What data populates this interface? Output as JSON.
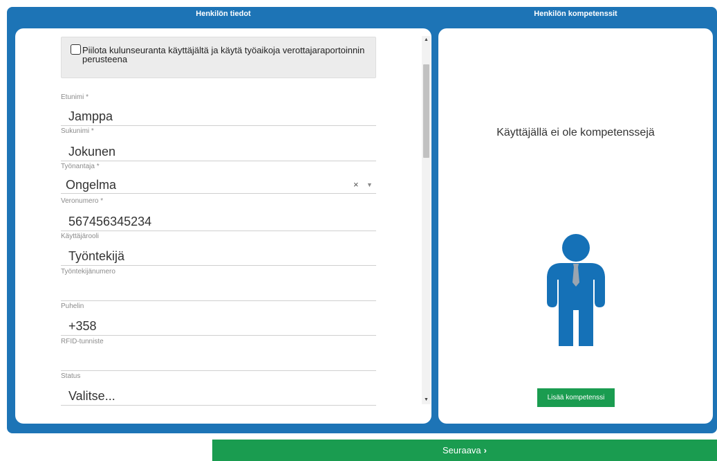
{
  "panels": {
    "left_title": "Henkilön tiedot",
    "right_title": "Henkilön kompetenssit"
  },
  "notice": {
    "checkbox_checked": false,
    "text": "Piilota kulunseuranta käyttäjältä ja käytä työaikoja verottajaraportoinnin perusteena"
  },
  "fields": {
    "first_name": {
      "label": "Etunimi",
      "required": "*",
      "value": "Jamppa"
    },
    "last_name": {
      "label": "Sukunimi",
      "required": "*",
      "value": "Jokunen"
    },
    "employer": {
      "label": "Työnantaja",
      "required": "*",
      "value": "Ongelma",
      "clear": "×",
      "arrow": "▼"
    },
    "tax_number": {
      "label": "Veronumero",
      "required": "*",
      "value": "567456345234"
    },
    "user_role": {
      "label": "Käyttäjärooli",
      "value": "Työntekijä"
    },
    "employee_number": {
      "label": "Työntekijänumero",
      "value": ""
    },
    "phone": {
      "label": "Puhelin",
      "value": "+358"
    },
    "rfid": {
      "label": "RFID-tunniste",
      "value": ""
    },
    "status": {
      "label": "Status",
      "value": "Valitse..."
    }
  },
  "competences": {
    "empty_message": "Käyttäjällä ei ole kompetenssejä",
    "add_button": "Lisää kompetenssi"
  },
  "footer": {
    "next_label": "Seuraava",
    "next_icon": "›"
  },
  "colors": {
    "frame_blue": "#1d74b6",
    "figure_blue": "#1571b7",
    "tie_gray": "#9aa5b0",
    "button_green": "#1a9c50"
  }
}
